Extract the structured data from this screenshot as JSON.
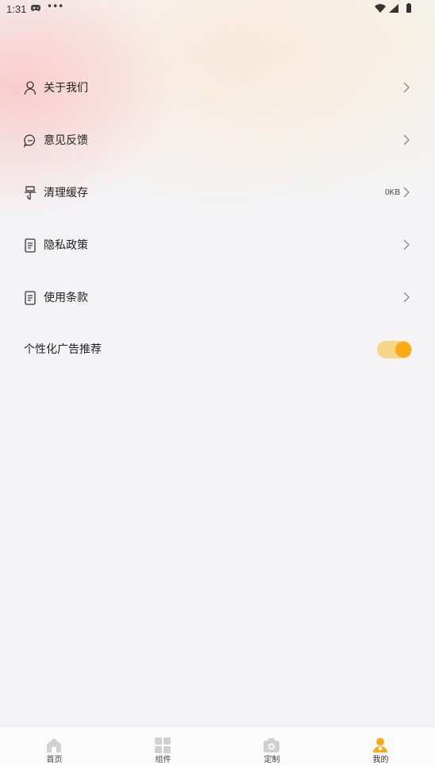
{
  "status_bar": {
    "time": "1:31",
    "dots": "•••"
  },
  "menu": {
    "items": [
      {
        "label": "关于我们",
        "icon": "person-icon"
      },
      {
        "label": "意见反馈",
        "icon": "chat-bubble-icon"
      },
      {
        "label": "清理缓存",
        "icon": "broom-icon",
        "value": "0KB"
      },
      {
        "label": "隐私政策",
        "icon": "document-icon"
      },
      {
        "label": "使用条款",
        "icon": "document-icon"
      }
    ]
  },
  "personalized_ads": {
    "label": "个性化广告推荐",
    "enabled": true
  },
  "tab_bar": {
    "tabs": [
      {
        "label": "首页",
        "icon": "home-icon",
        "active": false
      },
      {
        "label": "组件",
        "icon": "grid-icon",
        "active": false
      },
      {
        "label": "定制",
        "icon": "camera-icon",
        "active": false
      },
      {
        "label": "我的",
        "icon": "user-icon",
        "active": true
      }
    ]
  },
  "colors": {
    "accent": "#f9ab16",
    "toggle_track": "#f7d488",
    "inactive_icon": "#cfcfd4"
  }
}
